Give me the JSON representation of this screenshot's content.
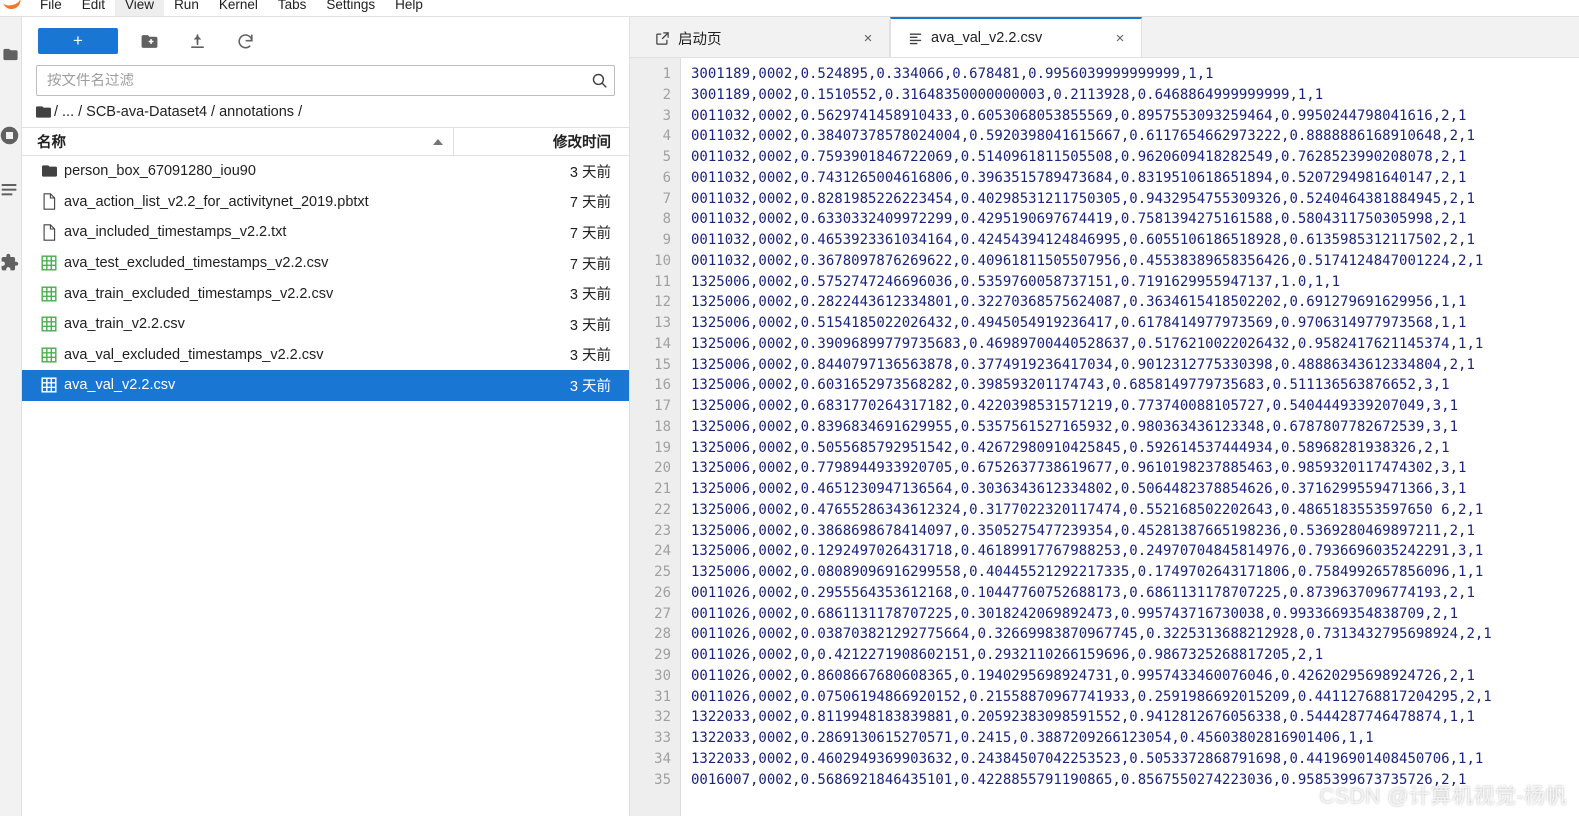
{
  "menubar": {
    "items": [
      {
        "label": "File",
        "active": false
      },
      {
        "label": "Edit",
        "active": false
      },
      {
        "label": "View",
        "active": true
      },
      {
        "label": "Run",
        "active": false
      },
      {
        "label": "Kernel",
        "active": false
      },
      {
        "label": "Tabs",
        "active": false
      },
      {
        "label": "Settings",
        "active": false
      },
      {
        "label": "Help",
        "active": false
      }
    ]
  },
  "activitybar": {
    "items": [
      {
        "name": "file-browser-icon",
        "selected": true
      },
      {
        "name": "running-terminals-icon",
        "selected": false
      },
      {
        "name": "commands-icon",
        "selected": false
      },
      {
        "name": "extension-manager-icon",
        "selected": false
      }
    ]
  },
  "filebrowser": {
    "toolbar": {
      "new_launcher_label": "+",
      "new_folder_icon": "new-folder-icon",
      "upload_icon": "upload-icon",
      "refresh_icon": "refresh-icon"
    },
    "filter": {
      "value": "",
      "placeholder": "按文件名过滤",
      "search_icon": "search-icon"
    },
    "breadcrumb": {
      "home_icon": "folder-icon",
      "parts": [
        "...",
        "SCB-ava-Dataset4",
        "annotations"
      ],
      "separator": "/"
    },
    "columns": {
      "name": "名称",
      "modified": "修改时间"
    },
    "items": [
      {
        "name": "person_box_67091280_iou90",
        "modified": "3 天前",
        "type": "folder",
        "selected": false
      },
      {
        "name": "ava_action_list_v2.2_for_activitynet_2019.pbtxt",
        "modified": "7 天前",
        "type": "file",
        "selected": false
      },
      {
        "name": "ava_included_timestamps_v2.2.txt",
        "modified": "7 天前",
        "type": "file",
        "selected": false
      },
      {
        "name": "ava_test_excluded_timestamps_v2.2.csv",
        "modified": "7 天前",
        "type": "csv",
        "selected": false
      },
      {
        "name": "ava_train_excluded_timestamps_v2.2.csv",
        "modified": "3 天前",
        "type": "csv",
        "selected": false
      },
      {
        "name": "ava_train_v2.2.csv",
        "modified": "3 天前",
        "type": "csv",
        "selected": false
      },
      {
        "name": "ava_val_excluded_timestamps_v2.2.csv",
        "modified": "3 天前",
        "type": "csv",
        "selected": false
      },
      {
        "name": "ava_val_v2.2.csv",
        "modified": "3 天前",
        "type": "csv",
        "selected": true
      }
    ]
  },
  "dock": {
    "tabs": [
      {
        "label": "启动页",
        "icon": "launcher-icon",
        "current": false,
        "close": "×"
      },
      {
        "label": "ava_val_v2.2.csv",
        "icon": "text-file-icon",
        "current": true,
        "close": "×"
      }
    ]
  },
  "editor": {
    "line_numbers": [
      1,
      2,
      3,
      4,
      5,
      6,
      7,
      8,
      9,
      10,
      11,
      12,
      13,
      14,
      15,
      16,
      17,
      18,
      19,
      20,
      21,
      22,
      23,
      24,
      25,
      26,
      27,
      28,
      29,
      30,
      31,
      32,
      33,
      34,
      35
    ],
    "lines": [
      "3001189,0002,0.524895,0.334066,0.678481,0.9956039999999999,1,1",
      "3001189,0002,0.1510552,0.31648350000000003,0.2113928,0.6468864999999999,1,1",
      "0011032,0002,0.5629741458910433,0.6053068053855569,0.8957553093259464,0.9950244798041616,2,1",
      "0011032,0002,0.38407378578024004,0.5920398041615667,0.6117654662973222,0.8888886168910648,2,1",
      "0011032,0002,0.7593901846722069,0.5140961811505508,0.9620609418282549,0.7628523990208078,2,1",
      "0011032,0002,0.7431265004616806,0.3963515789473684,0.8319510618651894,0.5207294981640147,2,1",
      "0011032,0002,0.8281985226223454,0.40298531211750305,0.9432954755309326,0.5240464381884945,2,1",
      "0011032,0002,0.6330332409972299,0.4295190697674419,0.7581394275161588,0.5804311750305998,2,1",
      "0011032,0002,0.4653923361034164,0.42454394124846995,0.6055106186518928,0.6135985312117502,2,1",
      "0011032,0002,0.3678097876269622,0.40961811505507956,0.45538389658356426,0.5174124847001224,2,1",
      "1325006,0002,0.5752747246696036,0.5359760058737151,0.7191629955947137,1.0,1,1",
      "1325006,0002,0.2822443612334801,0.32270368575624087,0.3634615418502202,0.691279691629956,1,1",
      "1325006,0002,0.5154185022026432,0.4945054919236417,0.6178414977973569,0.9706314977973568,1,1",
      "1325006,0002,0.39096899779735683,0.46989700440528637,0.5176210022026432,0.9582417621145374,1,1",
      "1325006,0002,0.8440797136563878,0.3774919236417034,0.9012312775330398,0.48886343612334804,2,1",
      "1325006,0002,0.6031652973568282,0.398593201174743,0.6858149779735683,0.511136563876652,3,1",
      "1325006,0002,0.6831770264317182,0.4220398531571219,0.773740088105727,0.5404449339207049,3,1",
      "1325006,0002,0.8396834691629955,0.5357561527165932,0.980363436123348,0.6787807782672539,3,1",
      "1325006,0002,0.5055685792951542,0.42672980910425845,0.592614537444934,0.58968281938326,2,1",
      "1325006,0002,0.7798944933920705,0.6752637738619677,0.9610198237885463,0.9859320117474302,3,1",
      "1325006,0002,0.4651230947136564,0.3036343612334802,0.5064482378854626,0.3716299559471366,3,1",
      "1325006,0002,0.47655286343612324,0.3177022320117474,0.552168502202643,0.4865183553597650 6,2,1",
      "1325006,0002,0.3868698678414097,0.3505275477239354,0.45281387665198236,0.5369280469897211,2,1",
      "1325006,0002,0.1292497026431718,0.46189917767988253,0.24970704845814976,0.7936696035242291,3,1",
      "1325006,0002,0.08089096916299558,0.40445521292217335,0.1749702643171806,0.7584992657856096,1,1",
      "0011026,0002,0.2955564353612168,0.10447760752688173,0.6861131178707225,0.8739637096774193,2,1",
      "0011026,0002,0.6861131178707225,0.3018242069892473,0.995743716730038,0.9933669354838709,2,1",
      "0011026,0002,0.038703821292775664,0.32669983870967745,0.3225313688212928,0.7313432795698924,2,1",
      "0011026,0002,0,0.4212271908602151,0.2932110266159696,0.9867325268817205,2,1",
      "0011026,0002,0.8608667680608365,0.1940295698924731,0.9957433460076046,0.42620295698924726,2,1",
      "0011026,0002,0.07506194866920152,0.21558870967741933,0.2591986692015209,0.44112768817204295,2,1",
      "1322033,0002,0.8119948183839881,0.20592383098591552,0.9412812676056338,0.5444287746478874,1,1",
      "1322033,0002,0.2869130615270571,0.2415,0.3887209266123054,0.45603802816901406,1,1",
      "1322033,0002,0.4602949369903632,0.24384507042253523,0.5053372868791698,0.44196901408450706,1,1",
      "0016007,0002,0.5686921846435101,0.4228855791190865,0.8567550274223036,0.9585399673735726,2,1"
    ]
  },
  "watermark": {
    "text": "CSDN @计算机视觉-杨帆"
  },
  "colors": {
    "accent": "#1976d2",
    "selection": "#1976d2",
    "csv_icon": "#4caf50",
    "code_text": "#1a237e",
    "gutter_bg": "#eeeeee"
  }
}
